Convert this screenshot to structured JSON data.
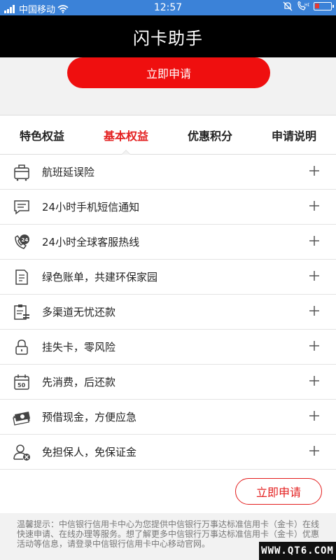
{
  "statusbar": {
    "carrier": "中国移动",
    "time": "12:57"
  },
  "header": {
    "title": "闪卡助手"
  },
  "apply_top_label": "立即申请",
  "tabs": [
    {
      "label": "特色权益",
      "active": false
    },
    {
      "label": "基本权益",
      "active": true
    },
    {
      "label": "优惠积分",
      "active": false
    },
    {
      "label": "申请说明",
      "active": false
    }
  ],
  "benefits": [
    {
      "label": "航班延误险",
      "icon": "luggage-icon"
    },
    {
      "label": "24小时手机短信通知",
      "icon": "message-icon"
    },
    {
      "label": "24小时全球客服热线",
      "icon": "phone-24-icon"
    },
    {
      "label": "绿色账单，共建环保家园",
      "icon": "document-icon"
    },
    {
      "label": "多渠道无忧还款",
      "icon": "clipboard-icon"
    },
    {
      "label": "挂失卡，零风险",
      "icon": "lock-icon"
    },
    {
      "label": "先消费，后还款",
      "icon": "calendar-icon"
    },
    {
      "label": "预借现金，方便应急",
      "icon": "cash-icon"
    },
    {
      "label": "免担保人，免保证金",
      "icon": "user-remove-icon"
    }
  ],
  "apply_bottom_label": "立即申请",
  "tip": "温馨提示：中信银行信用卡中心为您提供中信银行万事达标准信用卡（金卡）在线快速申请、在线办理等服务。想了解更多中信银行万事达标准信用卡（金卡）优惠活动等信息，请登录中信银行信用卡中心移动官网。",
  "watermark": "WWW.QT6.COM",
  "colors": {
    "accent": "#e31e1e",
    "header_bg": "#000000",
    "status_bg": "#3b82d8"
  }
}
